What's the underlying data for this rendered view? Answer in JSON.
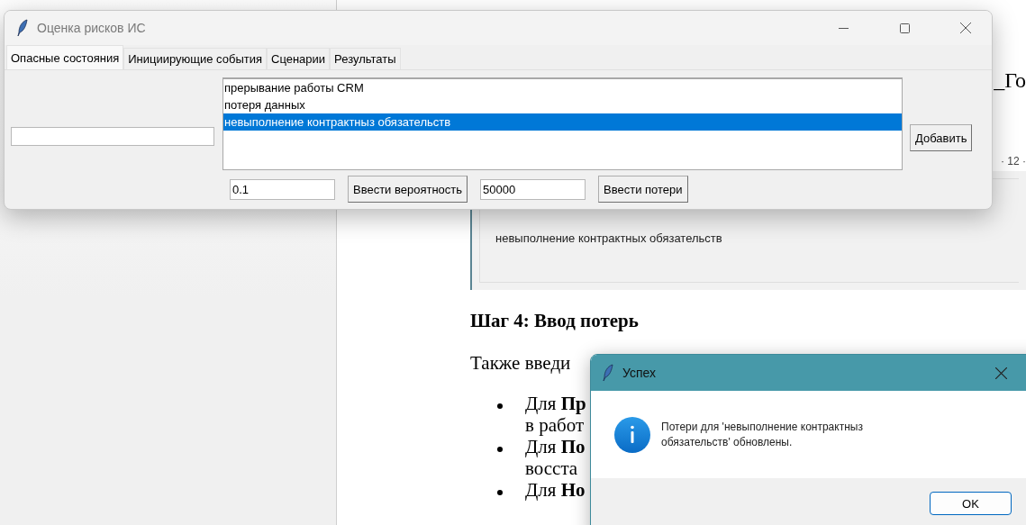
{
  "background_document": {
    "fragment_title": "_Го",
    "ruler_label": "· 12 ·",
    "box_item": "невыполнение контрактных обязательств",
    "heading": "Шаг 4: Ввод потерь",
    "paragraph": "Также введи",
    "bullets": [
      {
        "lines": [
          "Для **Пр**",
          "в работ"
        ]
      },
      {
        "lines": [
          "Для **По**",
          "восста"
        ]
      },
      {
        "lines": [
          "Для **Но**"
        ]
      }
    ]
  },
  "main_window": {
    "title": "Оценка рисков ИС",
    "tabs": [
      {
        "label": "Опасные состояния",
        "selected": true
      },
      {
        "label": "Инициирующие события",
        "selected": false
      },
      {
        "label": "Сценарии",
        "selected": false
      },
      {
        "label": "Результаты",
        "selected": false
      }
    ],
    "list_items": [
      {
        "label": "прерывание работы CRM",
        "selected": false
      },
      {
        "label": "потеря данных",
        "selected": false
      },
      {
        "label": "невыполнение контрактныз обязательств",
        "selected": true
      }
    ],
    "add_button": "Добавить",
    "probability_field": {
      "value": "0.1"
    },
    "probability_button": "Ввести вероятность",
    "loss_field": {
      "value": "50000"
    },
    "loss_button": "Ввести потери"
  },
  "dialog": {
    "title": "Успех",
    "message": "Потери для 'невыполнение контрактныз обязательств' обновлены.",
    "button": "OK"
  }
}
